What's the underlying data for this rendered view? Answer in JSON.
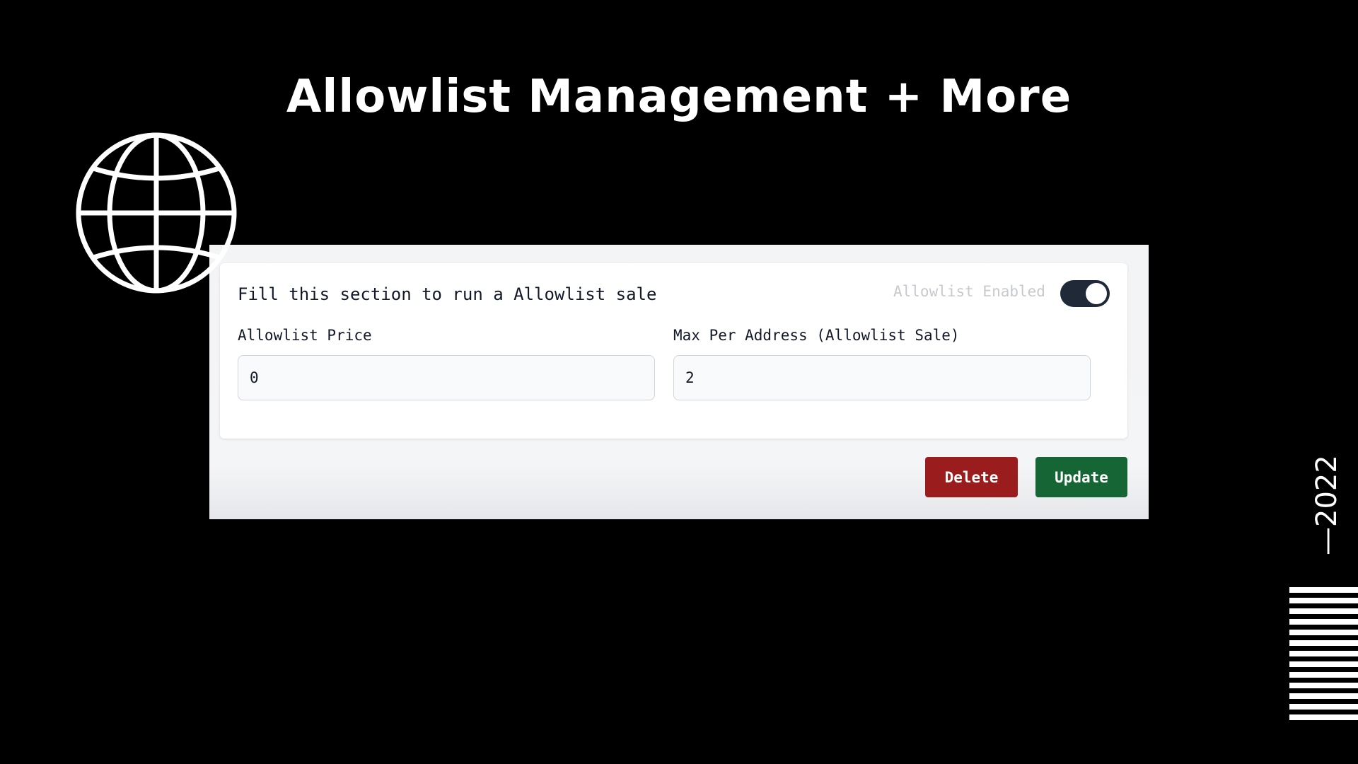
{
  "slide": {
    "title": "Allowlist Management + More",
    "year_mark": "—2022",
    "globe_icon": "globe-icon",
    "colors": {
      "background": "#000000",
      "title": "#ffffff",
      "delete": "#9b1c1c",
      "update": "#166534",
      "toggle_on": "#1f2937"
    }
  },
  "form": {
    "heading": "Fill this section to run a Allowlist sale",
    "toggle": {
      "label": "Allowlist Enabled",
      "state": "on"
    },
    "fields": [
      {
        "label": "Allowlist Price",
        "value": "0"
      },
      {
        "label": "Max Per Address (Allowlist Sale)",
        "value": "2"
      }
    ],
    "buttons": {
      "delete": "Delete",
      "update": "Update"
    }
  }
}
